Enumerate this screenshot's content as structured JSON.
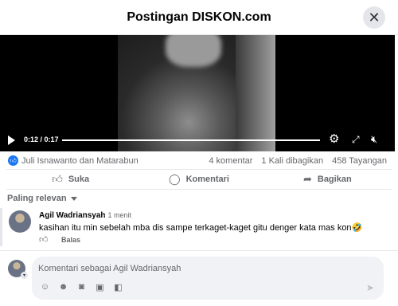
{
  "header": {
    "title": "Postingan DISKON.com",
    "close_glyph": "✕"
  },
  "video": {
    "time": "0:12 / 0:17",
    "progress": 0.7
  },
  "stats": {
    "reactors": "Juli Isnawanto dan Matarabun",
    "comments": "4 komentar",
    "shares": "1 Kali dibagikan",
    "views": "458 Tayangan"
  },
  "actions": {
    "like": "Suka",
    "comment": "Komentari",
    "share": "Bagikan"
  },
  "sort": {
    "label": "Paling relevan"
  },
  "comment": {
    "author": "Agil Wadriansyah",
    "time": "· 1 menit",
    "text": "kasihan itu min sebelah mba dis sampe terkaget-kaget gitu denger kata mas kon🤣",
    "reply": "Balas"
  },
  "composer": {
    "placeholder": "Komentari sebagai Agil Wadriansyah"
  },
  "colors": {
    "accent": "#1877f2",
    "muted": "#65676b"
  }
}
